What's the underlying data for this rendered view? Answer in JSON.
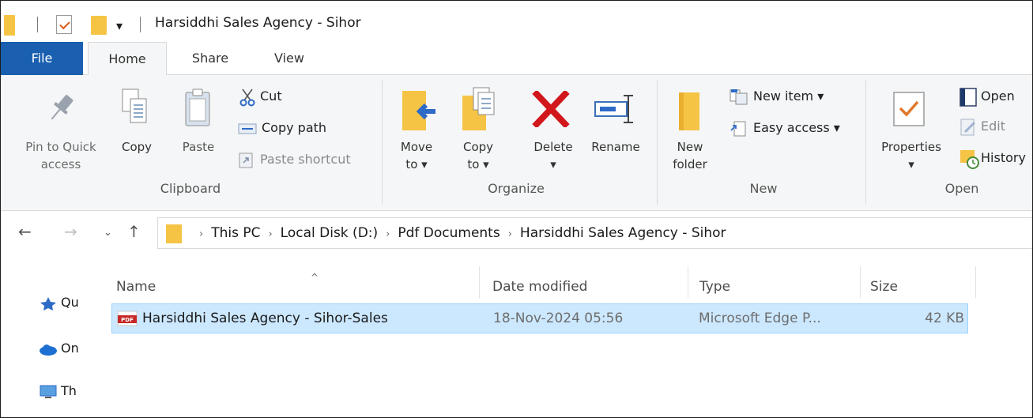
{
  "window": {
    "title": "Harsiddhi Sales Agency - Sihor"
  },
  "tabs": {
    "file": "File",
    "home": "Home",
    "share": "Share",
    "view": "View"
  },
  "ribbon": {
    "clipboard": {
      "label": "Clipboard",
      "pin_line1": "Pin to Quick",
      "pin_line2": "access",
      "copy": "Copy",
      "paste": "Paste",
      "cut": "Cut",
      "copy_path": "Copy path",
      "paste_shortcut": "Paste shortcut"
    },
    "organize": {
      "label": "Organize",
      "move_line1": "Move",
      "move_line2": "to ▾",
      "copy_line1": "Copy",
      "copy_line2": "to ▾",
      "delete": "Delete",
      "delete_arrow": "▾",
      "rename": "Rename"
    },
    "new": {
      "label": "New",
      "folder_line1": "New",
      "folder_line2": "folder",
      "new_item": "New item ▾",
      "easy_access": "Easy access ▾"
    },
    "open": {
      "label": "Open",
      "properties": "Properties",
      "properties_arrow": "▾",
      "open": "Open",
      "edit": "Edit",
      "history": "History"
    }
  },
  "address": {
    "crumbs": [
      "This PC",
      "Local Disk (D:)",
      "Pdf Documents",
      "Harsiddhi Sales Agency - Sihor"
    ]
  },
  "navpane": {
    "items": [
      "Qu",
      "On",
      "Th"
    ]
  },
  "list": {
    "columns": {
      "name": "Name",
      "date": "Date modified",
      "type": "Type",
      "size": "Size"
    },
    "sort_indicator": "^",
    "rows": [
      {
        "name": "Harsiddhi Sales Agency - Sihor-Sales",
        "date": "18-Nov-2024 05:56",
        "type": "Microsoft Edge P...",
        "size": "42 KB"
      }
    ]
  },
  "colors": {
    "file_tab": "#1a5fb0",
    "selection": "#cce8ff",
    "folder": "#f6c445",
    "delete": "#d1161c"
  }
}
